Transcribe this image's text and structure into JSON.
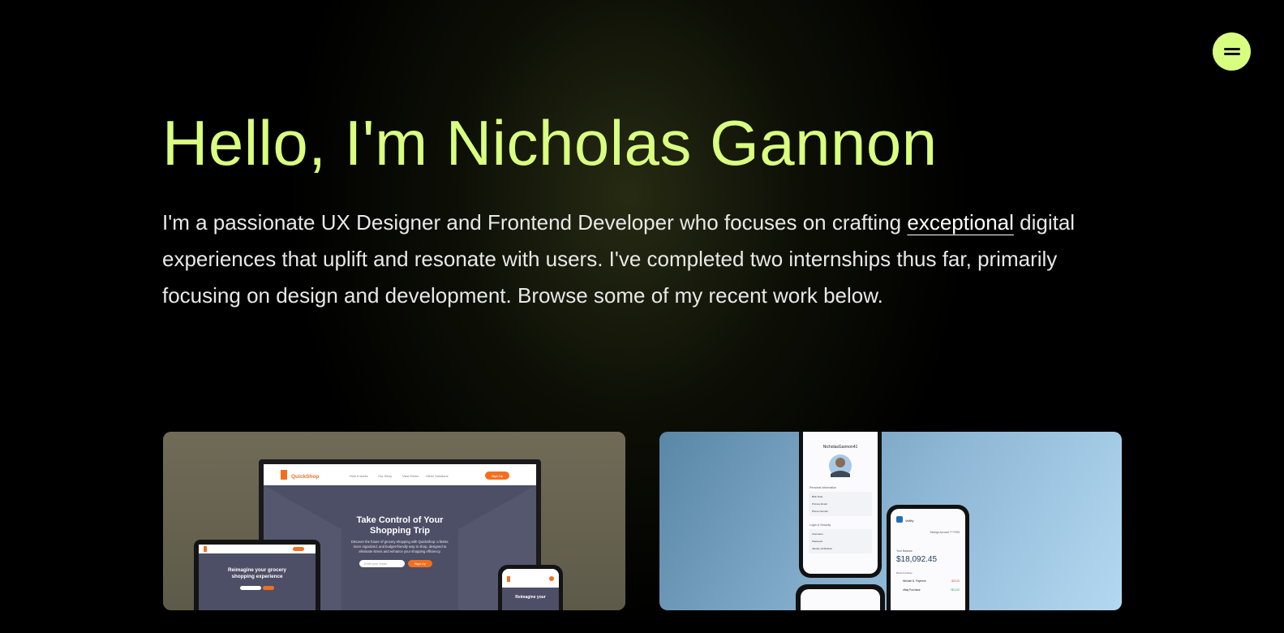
{
  "hero": {
    "title": "Hello, I'm Nicholas Gannon",
    "intro_before": "I'm a passionate UX Designer and Frontend Developer who focuses on crafting ",
    "intro_link": "exceptional",
    "intro_after": " digital experiences that uplift and resonate with users. I've completed two internships thus far, primarily focusing on design and development. Browse some of my recent work below."
  },
  "colors": {
    "accent": "#d9ff80",
    "background": "#000000",
    "text": "#e8e8e8"
  },
  "menu": {
    "icon": "hamburger-menu-icon"
  },
  "projects": [
    {
      "brand": "QuickShop",
      "nav": [
        "How it works",
        "Our Story",
        "View Demo",
        "Other Solutions"
      ],
      "signup": "Sign Up",
      "headline": [
        "Take Control of Your",
        "Shopping Trip"
      ],
      "body": [
        "Discover the future of grocery shopping with QuickShop: a faster,",
        "more organized, and budget-friendly way to shop, designed to",
        "eliminate stress and enhance your shopping efficiency."
      ],
      "email_placeholder": "Enter your email",
      "tablet_headline": [
        "Reimagine your grocery",
        "shopping experience"
      ],
      "phone_text": "Reimagine your"
    },
    {
      "username": "NicholasGannon41",
      "section_personal": "Personal Information",
      "section_security": "Login & Security",
      "rows_personal": [
        "Birth Date",
        "Primary Email",
        "Phone Number"
      ],
      "rows_security": [
        "Username",
        "Password",
        "Identity Verification"
      ],
      "app_name": "Vellity",
      "account": "Savings Account ****7933",
      "balance_label": "Your Balance",
      "balance": "$18,092.45",
      "recent_label": "Recent Activity",
      "tx": [
        "Michael D. Payment",
        "eBay Purchase"
      ],
      "tx_amounts": [
        "-$32.00",
        "+$12.00"
      ]
    }
  ]
}
